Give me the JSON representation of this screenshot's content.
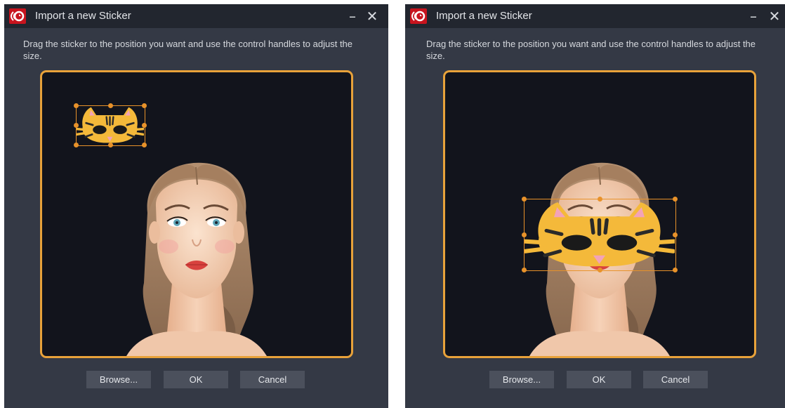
{
  "colors": {
    "window_bg": "#343945",
    "titlebar_bg": "#22262f",
    "accent_orange": "#e8a23a",
    "preview_bg": "#12141c",
    "button_bg": "#4b505c",
    "logo_red": "#c8141e"
  },
  "dialogs": [
    {
      "title": "Import a new Sticker",
      "minimize_glyph": "–",
      "close_glyph": "✕",
      "instruction": "Drag the sticker to the position you want and use the control handles to adjust the size.",
      "buttons": {
        "browse": "Browse...",
        "ok": "OK",
        "cancel": "Cancel"
      },
      "sticker_state": "small, top-left of preview"
    },
    {
      "title": "Import a new Sticker",
      "minimize_glyph": "–",
      "close_glyph": "✕",
      "instruction": "Drag the sticker to the position you want and use the control handles to adjust the size.",
      "buttons": {
        "browse": "Browse...",
        "ok": "OK",
        "cancel": "Cancel"
      },
      "sticker_state": "enlarged, placed over eyes"
    }
  ],
  "icons": {
    "app_logo": "app-logo-icon",
    "minimize": "minimize-icon",
    "close": "close-icon"
  }
}
